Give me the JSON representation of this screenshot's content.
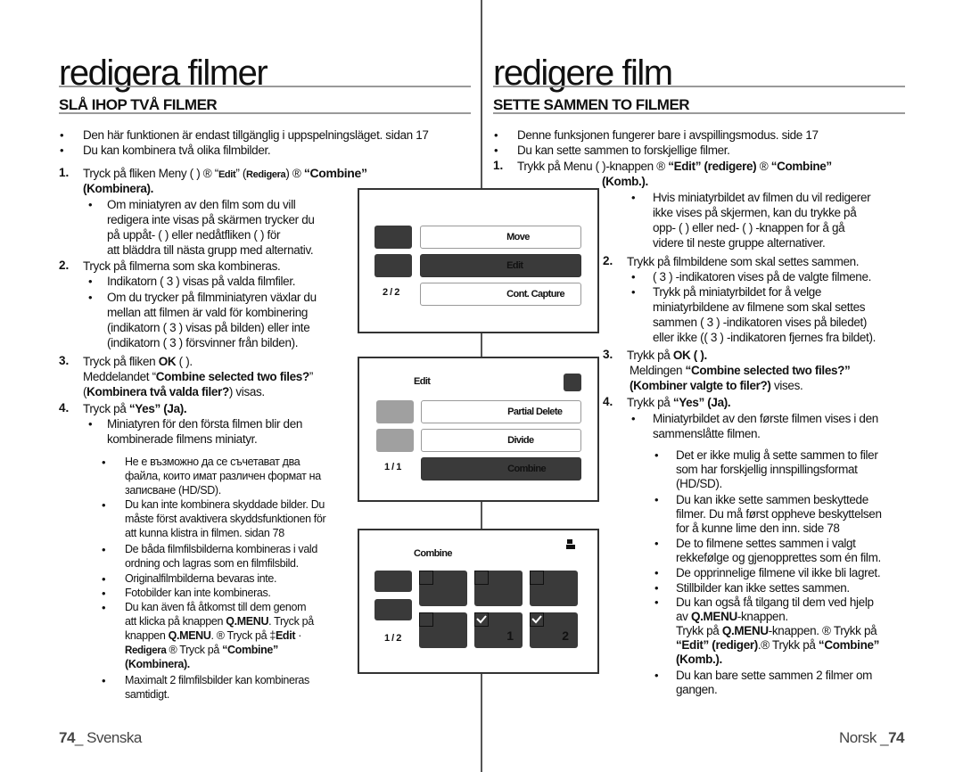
{
  "left": {
    "title": "redigera filmer",
    "subtitle": "SLÅ IHOP TVÅ FILMER",
    "intro": [
      "Den här funktionen är endast tillgänglig i uppspelningsläget.    sidan 17",
      "Du kan kombinera två olika filmbilder."
    ],
    "step1": {
      "num": "1.",
      "line1_a": "Tryck på fliken Meny (      ) ® “",
      "line1_edit": "Edit",
      "line1_b": "” (",
      "line1_redigera": "Redigera",
      "line1_c": ") ® ",
      "line1_combine": "“Combine”",
      "line2": "(Kombinera).",
      "bullet": [
        "Om miniatyren av den film som du vill",
        "redigera inte visas på skärmen trycker du",
        "på uppåt- (      ) eller nedåtfliken (      ) för",
        "att bläddra till nästa grupp med alternativ."
      ]
    },
    "step2": {
      "num": "2.",
      "text": "Tryck på filmerna som ska kombineras.",
      "bullets": [
        [
          "Indikatorn (  3 ) visas på valda filmfiler."
        ],
        [
          "Om du trycker på filmminiatyren växlar du",
          "mellan att filmen är vald för kombinering",
          "(indikatorn (  3 ) visas på bilden) eller inte",
          "(indikatorn (  3 ) försvinner från bilden)."
        ]
      ]
    },
    "step3": {
      "num": "3.",
      "line1_a": "Tryck på fliken ",
      "line1_ok": "OK",
      "line1_b": " (      ).",
      "line2_a": "Meddelandet “",
      "line2_bold": "Combine selected two files?",
      "line2_b": "”",
      "line3_a": "(",
      "line3_bold": "Kombinera två valda filer?",
      "line3_b": ") visas."
    },
    "step4": {
      "num": "4.",
      "text_a": "Tryck på ",
      "text_bold": "“Yes” (Ja).",
      "bullet": [
        "Miniatyren för den första filmen blir den",
        "kombinerade filmens miniatyr."
      ]
    },
    "notes": [
      [
        "Не е възможно да се съчетават два",
        "файла, които имат различен формат на",
        "записване (HD/SD)."
      ],
      [
        "Du kan inte kombinera skyddade bilder. Du",
        "måste först avaktivera skyddsfunktionen för",
        "att kunna klistra in filmen.    sidan 78"
      ],
      [
        "De båda filmfilsbilderna kombineras i vald",
        "ordning och lagras som en filmfilsbild."
      ],
      [
        "Originalfilmbilderna bevaras inte."
      ],
      [
        "Fotobilder kan inte kombineras."
      ]
    ],
    "qmenu_note": {
      "l1": "Du kan även få åtkomst till dem genom",
      "l2_a": "att klicka på knappen ",
      "l2_b": "Q.MENU",
      "l2_c": ". Tryck på",
      "l3_a": "knappen ",
      "l3_b": "Q.MENU",
      "l3_c": ". ® Tryck på  ‡",
      "l3_d": "Edit",
      "l3_e": " ·",
      "l4_a": " Redigera",
      "l4_b": "  ® Tryck på ",
      "l4_c": "“Combine”",
      "l5": "(Kombinera)."
    },
    "last_note": [
      "Maximalt 2 filmfilsbilder kan kombineras",
      "samtidigt."
    ],
    "footer": {
      "page": "74",
      "sep": "_ ",
      "lang": "Svenska"
    }
  },
  "right": {
    "title": "redigere film",
    "subtitle": "SETTE SAMMEN TO FILMER",
    "intro": [
      "Denne funksjonen fungerer bare i avspillingsmodus.    side 17",
      "Du kan sette sammen to forskjellige filmer."
    ],
    "step1": {
      "num": "1.",
      "line1_a": "Trykk på Menu (      )-knappen ® ",
      "line1_b": "“Edit” (redigere)",
      "line1_c": " ® ",
      "line1_d": "“Combine”",
      "line2": "(Komb.).",
      "bullet": [
        "Hvis miniatyrbildet av filmen du vil redigerer",
        "ikke vises på skjermen, kan du trykke på",
        "opp- (      ) eller ned- (      ) -knappen for å gå",
        "videre til neste gruppe alternativer."
      ]
    },
    "step2": {
      "num": "2.",
      "text": "Trykk på filmbildene som skal settes sammen.",
      "bullets": [
        [
          "(  3 ) -indikatoren vises på de valgte filmene."
        ],
        [
          "Trykk på miniatyrbildet for å velge",
          "miniatyrbildene av filmene som skal settes",
          "sammen (  3 ) -indikatoren vises på biledet)",
          "eller ikke ((  3 ) -indikatoren fjernes fra bildet)."
        ]
      ]
    },
    "step3": {
      "num": "3.",
      "line1_a": "Trykk på ",
      "line1_b": "OK (      ).",
      "line2_a": "Meldingen ",
      "line2_b": "“Combine selected two files?”",
      "line3_a": "(Kombiner valgte to filer?)",
      "line3_b": " vises."
    },
    "step4": {
      "num": "4.",
      "text_a": "Trykk på ",
      "text_b": "“Yes” (Ja).",
      "bullet": [
        "Miniatyrbildet av den første filmen vises i den",
        "sammenslåtte filmen."
      ]
    },
    "notes": [
      [
        "Det er ikke mulig å sette sammen to filer",
        "som har forskjellig innspillingsformat",
        "(HD/SD)."
      ],
      [
        "Du kan ikke sette sammen beskyttede",
        "filmer. Du må først oppheve beskyttelsen",
        "for å kunne lime den inn.    side 78"
      ],
      [
        "De to filmene settes sammen i valgt",
        "rekkefølge og gjenopprettes som én film."
      ],
      [
        "De opprinnelige filmene vil ikke bli lagret."
      ],
      [
        "Stillbilder kan ikke settes sammen."
      ]
    ],
    "qmenu_note": {
      "l1": "Du kan også få tilgang til dem ved hjelp",
      "l2_a": "av ",
      "l2_b": "Q.MENU",
      "l2_c": "-knappen.",
      "l3_a": "Trykk på ",
      "l3_b": "Q.MENU",
      "l3_c": "-knappen. ® Trykk på",
      "l4_a": "“Edit” (rediger)",
      "l4_b": ".® Trykk på ",
      "l4_c": "“Combine”",
      "l5": "(Komb.)."
    },
    "last_note": [
      "Du kan bare sette sammen 2 filmer om",
      "gangen."
    ],
    "footer": {
      "lang": "Norsk ",
      "sep": "_",
      "page": "74"
    }
  },
  "screens": {
    "menu": {
      "buttons": [
        "Move",
        "Edit",
        "Cont. Capture"
      ],
      "selected": "Edit",
      "page": "2 / 2"
    },
    "edit": {
      "title": "Edit",
      "buttons": [
        "Partial Delete",
        "Divide",
        "Combine"
      ],
      "selected": "Combine",
      "page": "1 / 1"
    },
    "combine": {
      "title": "Combine",
      "page": "1 / 2",
      "thumbnails": [
        {
          "checked": false,
          "order": ""
        },
        {
          "checked": false,
          "order": ""
        },
        {
          "checked": false,
          "order": ""
        },
        {
          "checked": false,
          "order": ""
        },
        {
          "checked": true,
          "order": "1"
        },
        {
          "checked": true,
          "order": "2"
        }
      ]
    }
  }
}
